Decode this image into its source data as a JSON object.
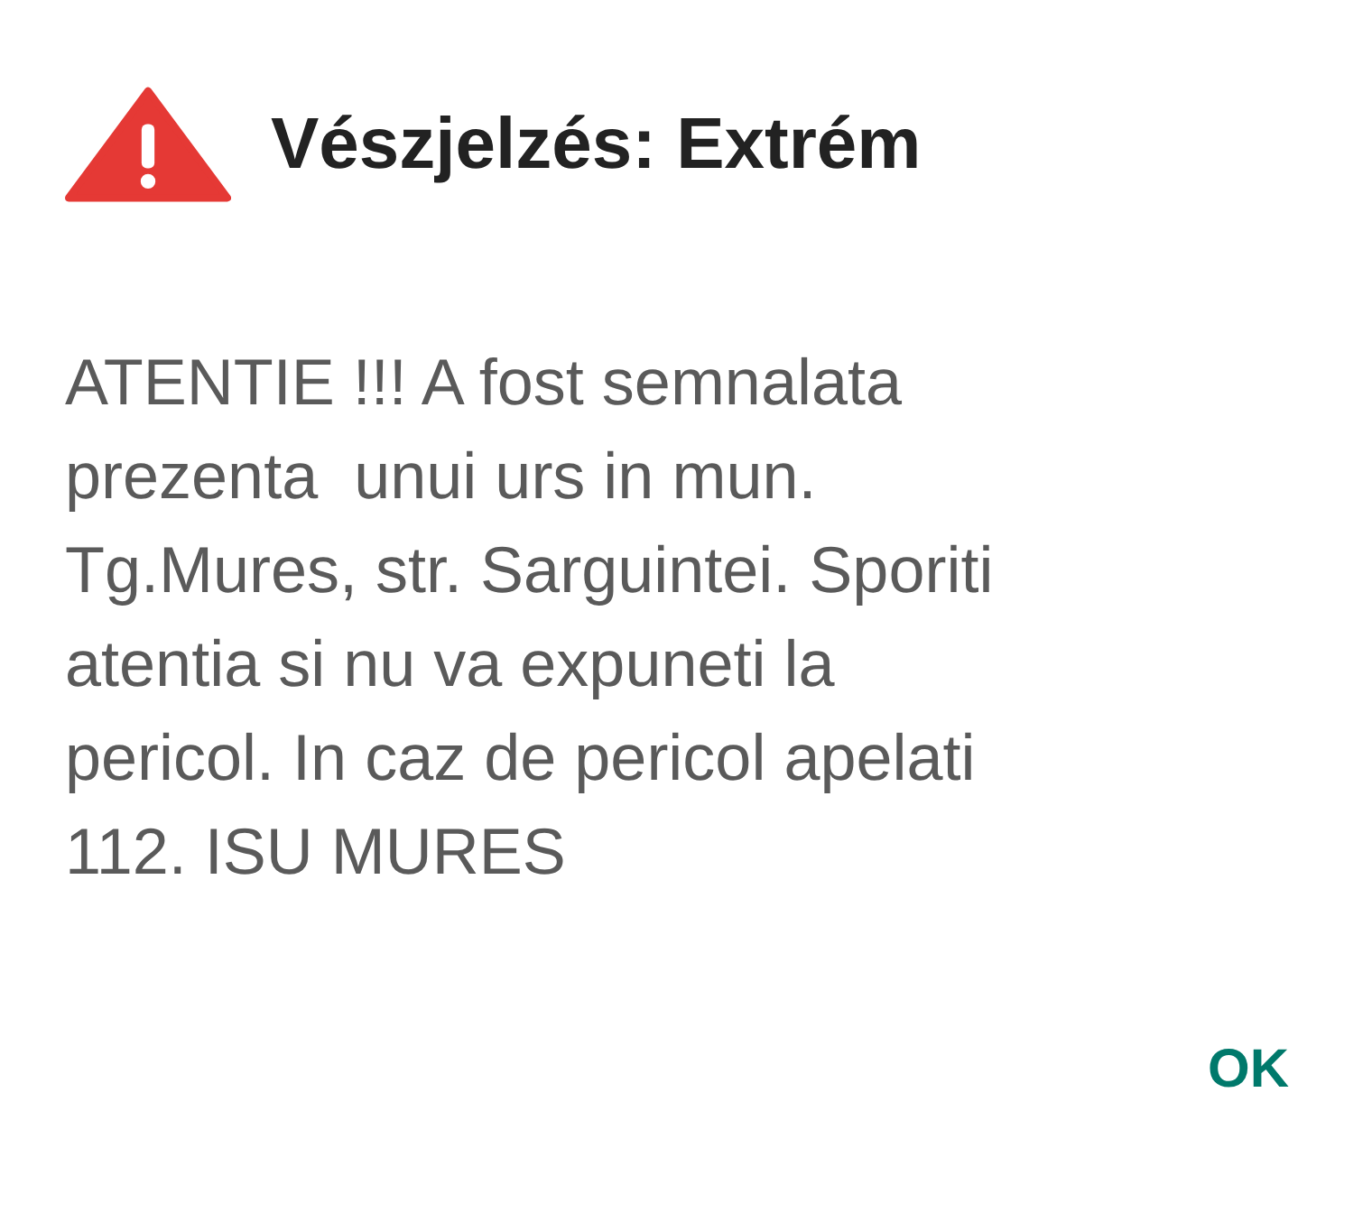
{
  "dialog": {
    "title": "Vészjelzés: Extrém",
    "message": "ATENTIE !!! A fost semnalata\nprezenta  unui urs in mun.\nTg.Mures, str. Sarguintei. Sporiti\natentia si nu va expuneti la\npericol. In caz de pericol apelati\n112. ISU MURES",
    "buttons": [
      "OK"
    ]
  }
}
